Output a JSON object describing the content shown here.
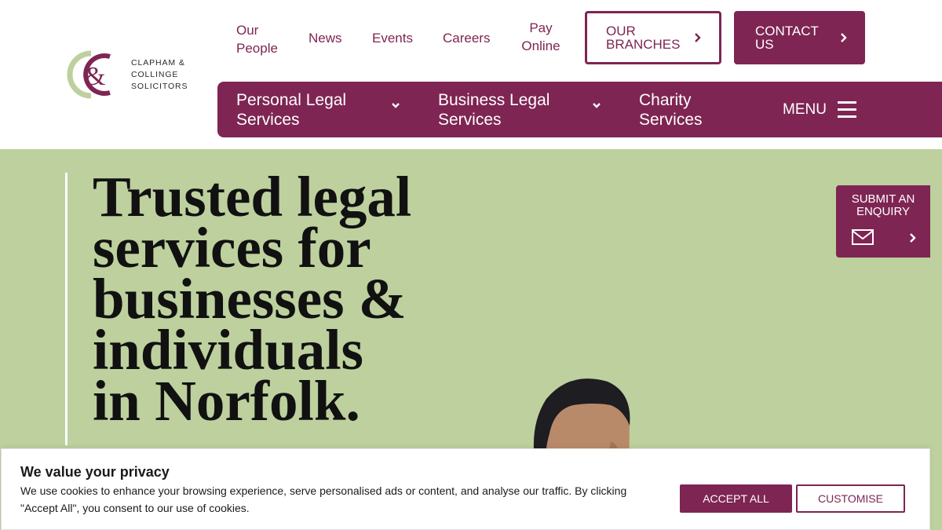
{
  "brand": {
    "name_lines": [
      "CLAPHAM &",
      "COLLINGE",
      "SOLICITORS"
    ],
    "monogram": "C&C",
    "primary_color": "#7e2553",
    "accent_color": "#bdd09e"
  },
  "top_nav": {
    "our_people": "Our People",
    "news": "News",
    "events": "Events",
    "careers": "Careers",
    "pay_online": "Pay Online",
    "our_branches": "OUR BRANCHES",
    "contact_us": "CONTACT US"
  },
  "main_nav": {
    "items": [
      {
        "label": "Personal Legal Services",
        "has_dropdown": true
      },
      {
        "label": "Business Legal Services",
        "has_dropdown": true
      },
      {
        "label": "Charity Services",
        "has_dropdown": false
      }
    ],
    "menu_label": "MENU"
  },
  "hero": {
    "title_lines": [
      "Trusted legal",
      "services for",
      "businesses &",
      "individuals",
      "in Norfolk."
    ],
    "enquiry_label": "SUBMIT AN ENQUIRY"
  },
  "cookie_banner": {
    "title": "We value your privacy",
    "text": "We use cookies to enhance your browsing experience, serve personalised ads or content, and analyse our traffic. By clicking \"Accept All\", you consent to our use of cookies.",
    "accept_label": "ACCEPT ALL",
    "customise_label": "CUSTOMISE"
  },
  "icons": [
    "chevron-right-icon",
    "chevron-down-icon",
    "hamburger-icon",
    "mail-icon"
  ]
}
